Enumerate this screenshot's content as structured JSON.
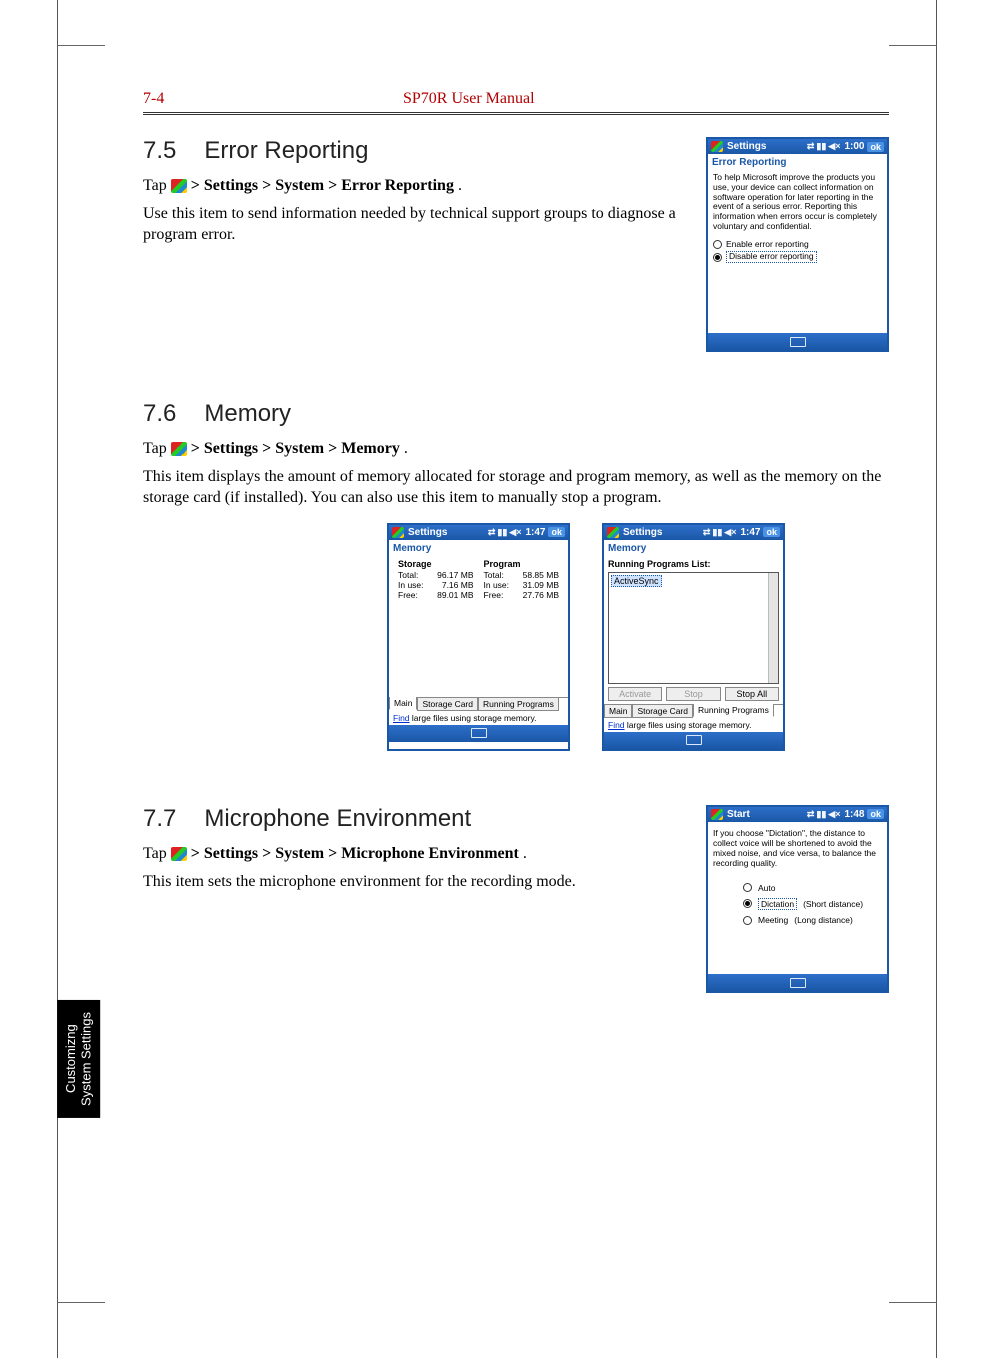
{
  "header": {
    "page_num": "7-4",
    "manual_title": "SP70R User Manual"
  },
  "side_tab": {
    "line1": "Customizng",
    "line2": "System Settings"
  },
  "sec75": {
    "num": "7.5",
    "title": "Error Reporting",
    "tap_prefix": "Tap ",
    "tap_path": " > Settings > System > Error Reporting",
    "period": ".",
    "body": "Use this item to send information needed by technical support groups to diagnose a program error."
  },
  "sec76": {
    "num": "7.6",
    "title": "Memory",
    "tap_prefix": "Tap ",
    "tap_path": " > Settings > System > Memory",
    "period": ".",
    "body": "This item displays the amount of memory allocated for storage and program memory, as well as the memory on the storage card (if installed). You can also use this item to manually stop a program."
  },
  "sec77": {
    "num": "7.7",
    "title": "Microphone Environment",
    "tap_prefix": "Tap ",
    "tap_path": " > Settings > System > Microphone Environment",
    "period": ".",
    "body": "This item sets the microphone environment for the recording mode."
  },
  "ss_err": {
    "title": "Settings",
    "time": "1:00",
    "ok": "ok",
    "subtitle": "Error Reporting",
    "para": "To help Microsoft improve the products you use, your device can collect information on software operation for later reporting in the event of a serious error. Reporting this information when errors occur is completely voluntary and confidential.",
    "opt_enable": "Enable error reporting",
    "opt_disable": "Disable error reporting"
  },
  "ss_mem_main": {
    "title": "Settings",
    "time": "1:47",
    "ok": "ok",
    "subtitle": "Memory",
    "storage_h": "Storage",
    "program_h": "Program",
    "rows": {
      "total_l": "Total:",
      "inuse_l": "In use:",
      "free_l": "Free:",
      "s_total": "96.17 MB",
      "s_inuse": "7.16 MB",
      "s_free": "89.01 MB",
      "p_total": "58.85 MB",
      "p_inuse": "31.09 MB",
      "p_free": "27.76 MB"
    },
    "tabs": {
      "main": "Main",
      "card": "Storage Card",
      "run": "Running Programs"
    },
    "find_label": "Find",
    "find_rest": " large files using storage memory."
  },
  "ss_mem_run": {
    "title": "Settings",
    "time": "1:47",
    "ok": "ok",
    "subtitle": "Memory",
    "list_label": "Running Programs List:",
    "list_item": "ActiveSync",
    "btn_activate": "Activate",
    "btn_stop": "Stop",
    "btn_stopall": "Stop All",
    "tabs": {
      "main": "Main",
      "card": "Storage Card",
      "run": "Running Programs"
    },
    "find_label": "Find",
    "find_rest": " large files using storage memory."
  },
  "ss_mic": {
    "title": "Start",
    "time": "1:48",
    "ok": "ok",
    "para": "If you choose \"Dictation\", the distance to collect voice will be shortened to avoid the mixed noise, and vice versa, to balance the recording quality.",
    "opt_auto": "Auto",
    "opt_dict": "Dictation",
    "opt_dict_note": "(Short distance)",
    "opt_meet": "Meeting",
    "opt_meet_note": "(Long distance)"
  }
}
